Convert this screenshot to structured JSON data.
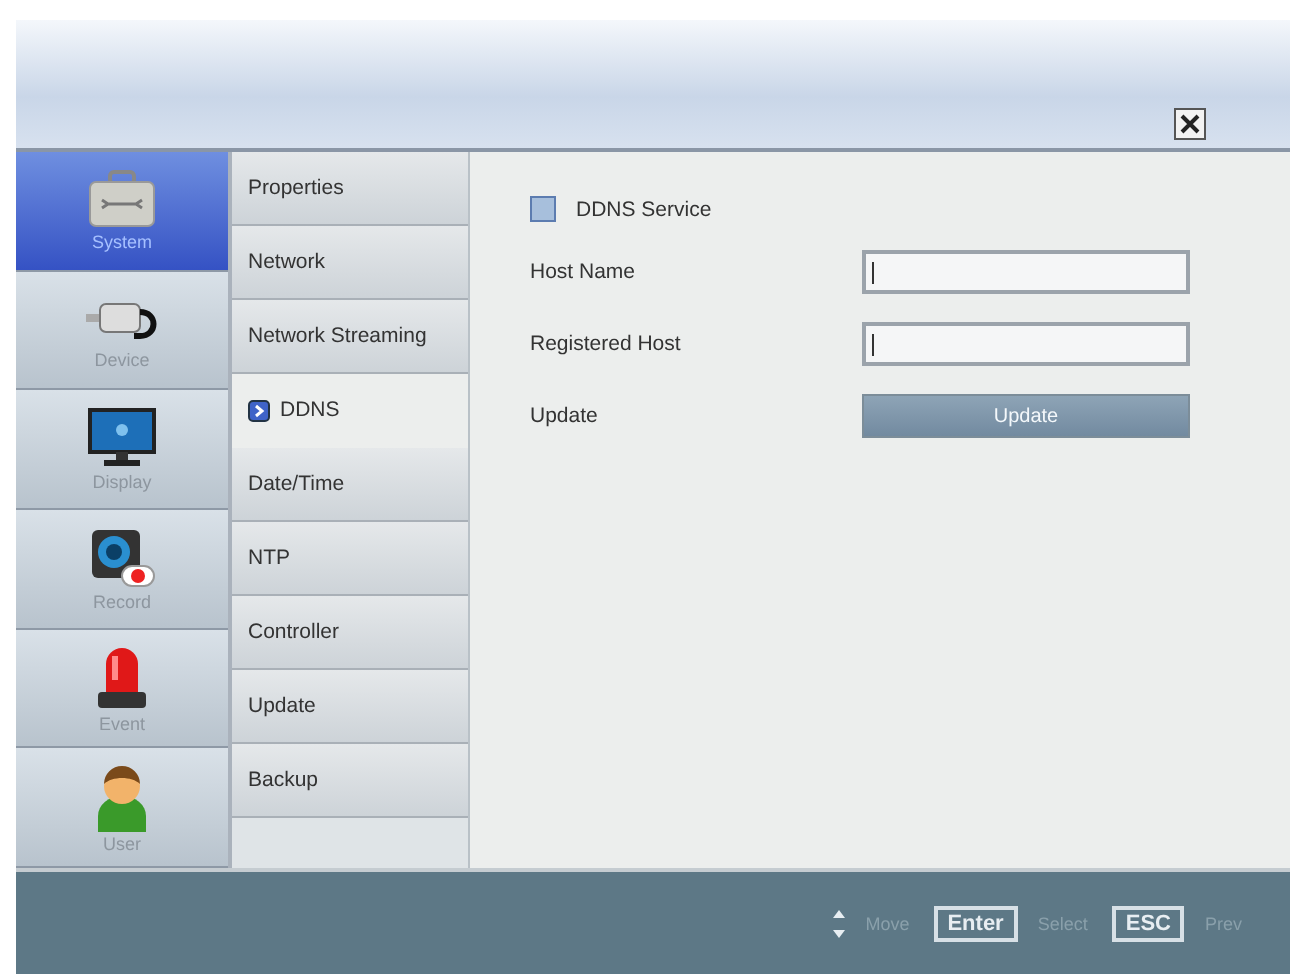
{
  "categories": [
    {
      "label": "System",
      "selected": true
    },
    {
      "label": "Device",
      "selected": false
    },
    {
      "label": "Display",
      "selected": false
    },
    {
      "label": "Record",
      "selected": false
    },
    {
      "label": "Event",
      "selected": false
    },
    {
      "label": "User",
      "selected": false
    }
  ],
  "submenu": [
    {
      "label": "Properties",
      "selected": false
    },
    {
      "label": "Network",
      "selected": false
    },
    {
      "label": "Network Streaming",
      "selected": false
    },
    {
      "label": "DDNS",
      "selected": true
    },
    {
      "label": "Date/Time",
      "selected": false
    },
    {
      "label": "NTP",
      "selected": false
    },
    {
      "label": "Controller",
      "selected": false
    },
    {
      "label": "Update",
      "selected": false
    },
    {
      "label": "Backup",
      "selected": false
    }
  ],
  "panel": {
    "service": {
      "label": "DDNS Service",
      "checked": false
    },
    "rows": [
      {
        "kind": "input",
        "label": "Host Name"
      },
      {
        "kind": "input",
        "label": "Registered Host"
      },
      {
        "kind": "button",
        "label": "Update",
        "button_label": "Update",
        "disabled": true
      }
    ]
  },
  "footer": [
    {
      "kind": "arrows",
      "label": "Move"
    },
    {
      "kind": "key",
      "key": "Enter",
      "label": "Select"
    },
    {
      "kind": "key",
      "key": "ESC",
      "label": "Prev"
    }
  ]
}
